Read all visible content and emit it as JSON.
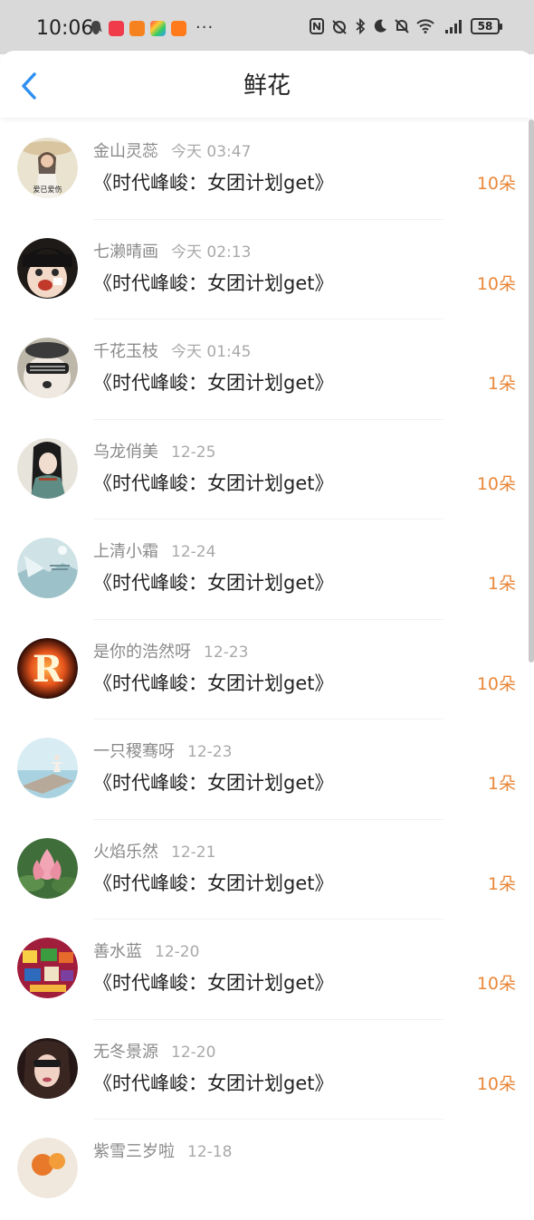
{
  "status_bar": {
    "time": "10:06",
    "battery": "58",
    "dots": "···"
  },
  "header": {
    "title": "鲜花",
    "back_icon": "chevron-left-icon",
    "accent_color": "#2f8ff0"
  },
  "list": [
    {
      "name": "金山灵蕊",
      "time": "今天 03:47",
      "book": "《时代峰峻：女团计划get》",
      "count": "10朵"
    },
    {
      "name": "七濑晴画",
      "time": "今天 02:13",
      "book": "《时代峰峻：女团计划get》",
      "count": "10朵"
    },
    {
      "name": "千花玉枝",
      "time": "今天 01:45",
      "book": "《时代峰峻：女团计划get》",
      "count": "1朵"
    },
    {
      "name": "乌龙俏美",
      "time": "12-25",
      "book": "《时代峰峻：女团计划get》",
      "count": "10朵"
    },
    {
      "name": "上清小霜",
      "time": "12-24",
      "book": "《时代峰峻：女团计划get》",
      "count": "1朵"
    },
    {
      "name": "是你的浩然呀",
      "time": "12-23",
      "book": "《时代峰峻：女团计划get》",
      "count": "10朵"
    },
    {
      "name": "一只稷骞呀",
      "time": "12-23",
      "book": "《时代峰峻：女团计划get》",
      "count": "1朵"
    },
    {
      "name": "火焰乐然",
      "time": "12-21",
      "book": "《时代峰峻：女团计划get》",
      "count": "1朵"
    },
    {
      "name": "善水蓝",
      "time": "12-20",
      "book": "《时代峰峻：女团计划get》",
      "count": "10朵"
    },
    {
      "name": "无冬景源",
      "time": "12-20",
      "book": "《时代峰峻：女团计划get》",
      "count": "10朵"
    },
    {
      "name": "紫雪三岁啦",
      "time": "12-18",
      "book": "",
      "count": ""
    }
  ],
  "avatar_text": {
    "first": "爱已爱伤",
    "sixth": "R"
  },
  "colors": {
    "count": "#e8873a",
    "name": "#8a8a8a",
    "book": "#222222"
  }
}
